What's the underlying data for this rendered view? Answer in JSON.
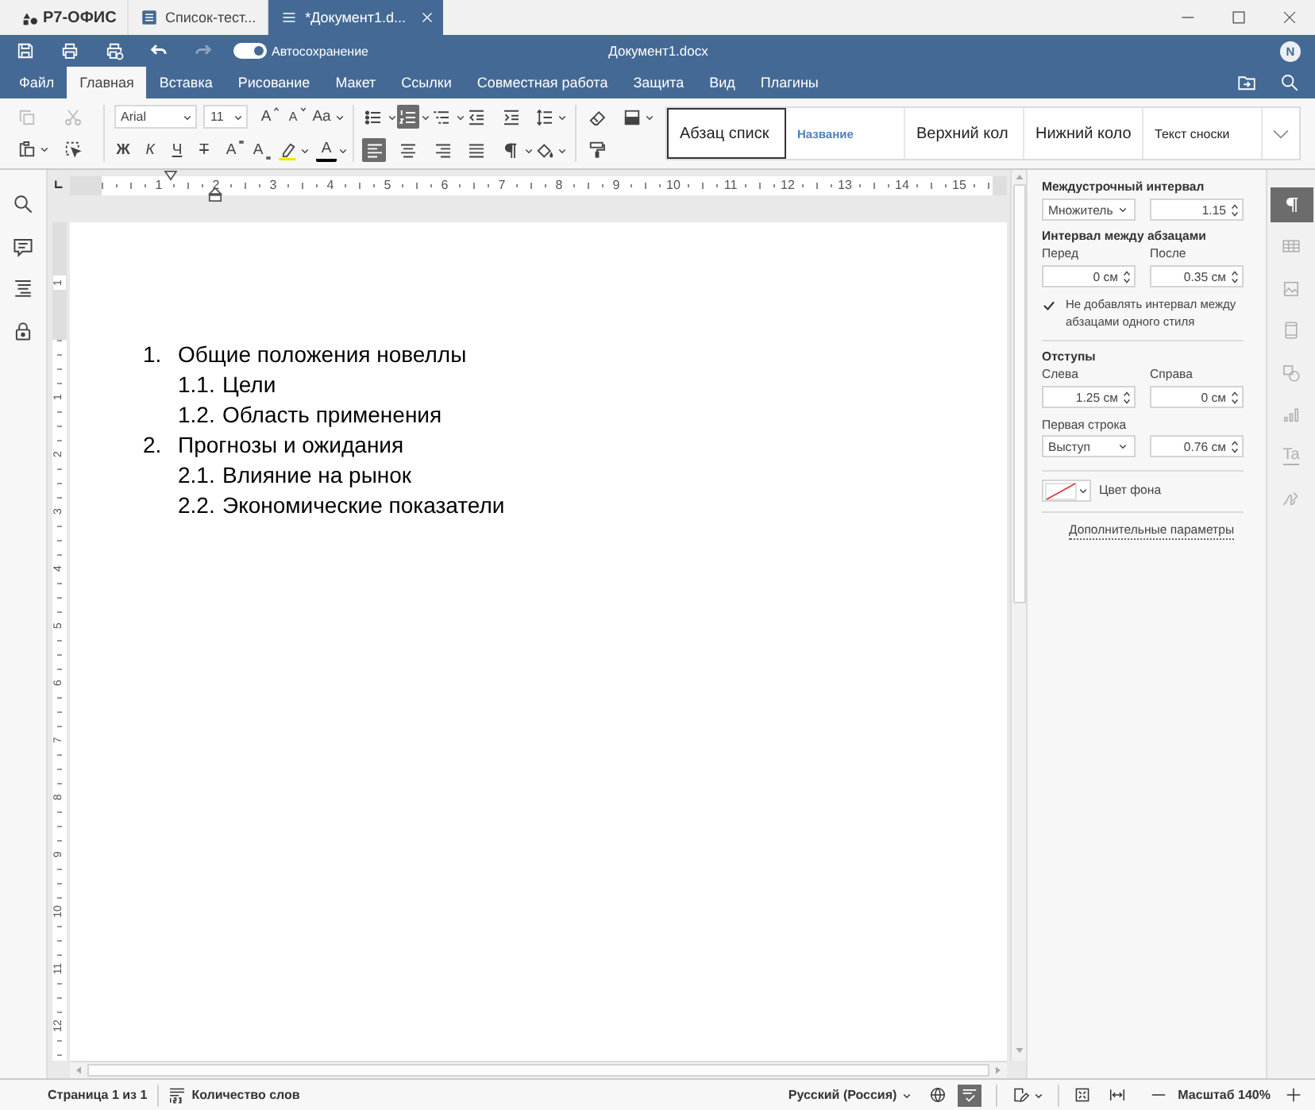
{
  "titlebar": {
    "logo": "Р7-ОФИС",
    "tabs": [
      {
        "label": "Список-тест...",
        "selected": false
      },
      {
        "label": "*Документ1.d...",
        "selected": true
      }
    ]
  },
  "header": {
    "actions": [
      {
        "kind": "save",
        "disabled": false
      },
      {
        "kind": "print",
        "disabled": false
      },
      {
        "kind": "quick-print",
        "disabled": false
      },
      {
        "kind": "undo",
        "disabled": false
      },
      {
        "kind": "redo",
        "disabled": true
      }
    ],
    "autosave": {
      "label": "Автосохранение",
      "on": true
    },
    "title": "Документ1.docx",
    "user_initial": "N"
  },
  "menu": {
    "tabs": [
      {
        "label": "Файл",
        "selected": false
      },
      {
        "label": "Главная",
        "selected": true
      },
      {
        "label": "Вставка",
        "selected": false
      },
      {
        "label": "Рисование",
        "selected": false
      },
      {
        "label": "Макет",
        "selected": false
      },
      {
        "label": "Ссылки",
        "selected": false
      },
      {
        "label": "Совместная работа",
        "selected": false
      },
      {
        "label": "Защита",
        "selected": false
      },
      {
        "label": "Вид",
        "selected": false
      },
      {
        "label": "Плагины",
        "selected": false
      }
    ],
    "actions": [
      {
        "kind": "open-location"
      },
      {
        "kind": "search"
      }
    ]
  },
  "toolbar": {
    "clipboard": [
      {
        "kind": "copy",
        "disabled": true
      },
      {
        "kind": "cut",
        "disabled": true
      },
      {
        "kind": "paste",
        "disabled": false
      },
      {
        "kind": "select-all",
        "disabled": false
      }
    ],
    "font": {
      "name": "Arial",
      "size": "11"
    },
    "font_buttons": [
      {
        "kind": "grow-font",
        "glyph": "A"
      },
      {
        "kind": "shrink-font",
        "glyph": "A"
      },
      {
        "kind": "change-case",
        "glyph": "Aa"
      }
    ],
    "format_buttons": [
      {
        "kind": "bold",
        "glyph": "Ж"
      },
      {
        "kind": "italic",
        "glyph": "К"
      },
      {
        "kind": "underline",
        "glyph": "Ч"
      },
      {
        "kind": "strikethrough",
        "glyph": "Т"
      },
      {
        "kind": "superscript",
        "glyph": "A"
      },
      {
        "kind": "subscript",
        "glyph": "A"
      },
      {
        "kind": "highlight"
      },
      {
        "kind": "font-color",
        "glyph": "A"
      }
    ],
    "list_types": [
      {
        "kind": "bullets",
        "selected": false
      },
      {
        "kind": "numbering",
        "selected": true
      },
      {
        "kind": "multilevel",
        "selected": false
      }
    ],
    "indent_buttons": [
      {
        "kind": "indent-decrease"
      },
      {
        "kind": "indent-increase"
      },
      {
        "kind": "line-spacing"
      }
    ],
    "alignment": [
      {
        "kind": "align-left",
        "selected": true
      },
      {
        "kind": "align-center",
        "selected": false
      },
      {
        "kind": "align-right",
        "selected": false
      },
      {
        "kind": "justify",
        "selected": false
      }
    ],
    "paragraph_buttons": [
      {
        "kind": "nonprinting"
      },
      {
        "kind": "shading"
      }
    ],
    "style_buttons": [
      {
        "kind": "clear-style"
      },
      {
        "kind": "fill"
      },
      {
        "kind": "copy-style"
      }
    ],
    "styles": [
      {
        "label": "Абзац списк",
        "kind": "list-paragraph",
        "selected": true
      },
      {
        "label": "Название",
        "kind": "title",
        "selected": false
      },
      {
        "label": "Верхний кол",
        "kind": "header",
        "selected": false
      },
      {
        "label": "Нижний коло",
        "kind": "footer",
        "selected": false
      },
      {
        "label": "Текст сноски",
        "kind": "footnote",
        "selected": false
      }
    ]
  },
  "left_sidebar": [
    {
      "kind": "search"
    },
    {
      "kind": "comments"
    },
    {
      "kind": "navigation"
    },
    {
      "kind": "protection"
    }
  ],
  "ruler": {
    "horizontal": [
      "1",
      "2",
      "3",
      "4",
      "5",
      "6",
      "7",
      "8",
      "9",
      "10",
      "11",
      "12",
      "13",
      "14",
      "15"
    ],
    "vertical": [
      "1",
      "1",
      "2",
      "3",
      "4",
      "5",
      "6",
      "7",
      "8",
      "9",
      "10",
      "11",
      "12"
    ]
  },
  "document": {
    "list": [
      {
        "number": "1.",
        "text": "Общие положения новеллы",
        "children": [
          {
            "number": "1.1.",
            "text": "Цели"
          },
          {
            "number": "1.2.",
            "text": "Область применения"
          }
        ]
      },
      {
        "number": "2.",
        "text": "Прогнозы и ожидания",
        "children": [
          {
            "number": "2.1.",
            "text": "Влияние на рынок"
          },
          {
            "number": "2.2.",
            "text": "Экономические показатели"
          }
        ]
      }
    ]
  },
  "paragraph_panel": {
    "line_spacing": {
      "title": "Междустрочный интервал",
      "mode": "Множитель",
      "value": "1.15"
    },
    "spacing": {
      "title": "Интервал между абзацами",
      "before": {
        "label": "Перед",
        "value": "0 см"
      },
      "after": {
        "label": "После",
        "value": "0.35 см"
      },
      "no_space_same_style": {
        "label": "Не добавлять интервал между абзацами одного стиля",
        "checked": true
      }
    },
    "indents": {
      "title": "Отступы",
      "left": {
        "label": "Слева",
        "value": "1.25 см"
      },
      "right": {
        "label": "Справа",
        "value": "0 см"
      },
      "first_line": {
        "label": "Первая строка",
        "mode": "Выступ",
        "value": "0.76 см"
      }
    },
    "background": {
      "label": "Цвет фона"
    },
    "advanced_link": "Дополнительные параметры"
  },
  "side_tabs": [
    {
      "kind": "paragraph",
      "selected": true,
      "disabled": false
    },
    {
      "kind": "table",
      "selected": false,
      "disabled": true
    },
    {
      "kind": "image",
      "selected": false,
      "disabled": true
    },
    {
      "kind": "header-footer",
      "selected": false,
      "disabled": true
    },
    {
      "kind": "shape",
      "selected": false,
      "disabled": true
    },
    {
      "kind": "chart",
      "selected": false,
      "disabled": true
    },
    {
      "kind": "text-art",
      "glyph": "Ta",
      "selected": false,
      "disabled": true
    },
    {
      "kind": "signature",
      "selected": false,
      "disabled": true
    }
  ],
  "status_bar": {
    "page": "Страница 1 из 1",
    "word_count": "Количество слов",
    "language": "Русский (Россия)",
    "spellcheck": {
      "on": true
    },
    "zoom": "Масштаб 140%"
  }
}
